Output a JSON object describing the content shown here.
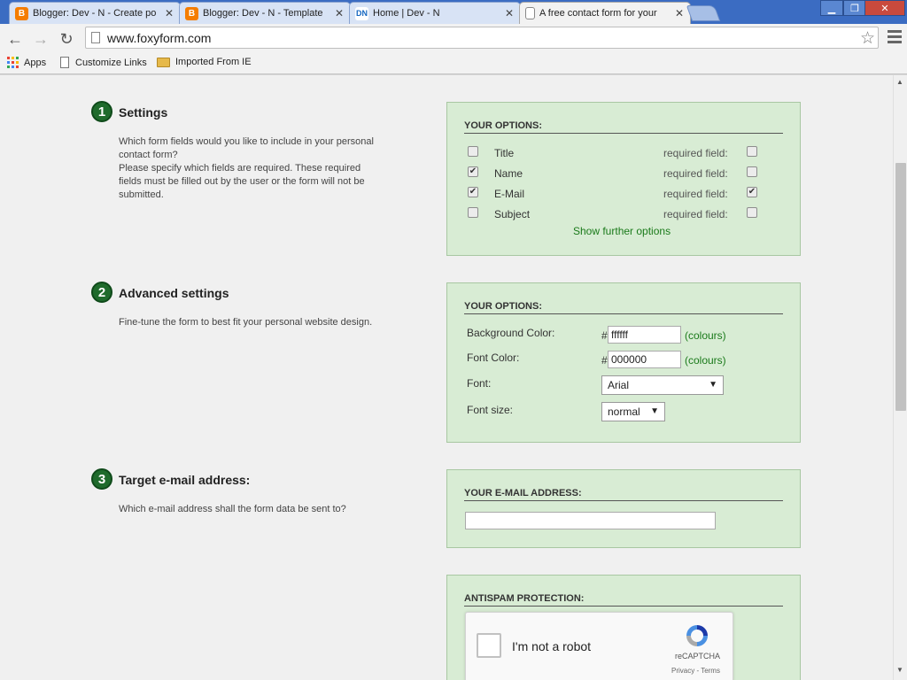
{
  "browser": {
    "tabs": [
      {
        "title": "Blogger: Dev - N - Create po",
        "favicon": "blogger-icon"
      },
      {
        "title": "Blogger: Dev - N - Template",
        "favicon": "blogger-icon"
      },
      {
        "title": "Home | Dev - N",
        "favicon": "devn-icon"
      },
      {
        "title": "A free contact form for your",
        "favicon": "page-icon"
      }
    ],
    "url": "www.foxyform.com",
    "bookmarks": [
      {
        "label": "Apps",
        "icon": "apps-icon"
      },
      {
        "label": "Customize Links",
        "icon": "page-icon"
      },
      {
        "label": "Imported From IE",
        "icon": "folder-icon"
      }
    ]
  },
  "steps": [
    {
      "number": "1",
      "title": "Settings",
      "description": [
        "Which form fields would you like to include in your personal",
        "contact form?",
        "Please specify which fields are required. These required",
        "fields must be filled out by the user or the form will not be",
        "submitted."
      ]
    },
    {
      "number": "2",
      "title": "Advanced settings",
      "description": [
        "Fine-tune the form to best fit your personal website design."
      ]
    },
    {
      "number": "3",
      "title": "Target e-mail address:",
      "description": [
        "Which e-mail address shall the form data be sent to?"
      ]
    }
  ],
  "panel1": {
    "heading": "YOUR OPTIONS:",
    "required_label": "required field:",
    "fields": [
      {
        "label": "Title",
        "included": false,
        "required": false
      },
      {
        "label": "Name",
        "included": true,
        "required": false
      },
      {
        "label": "E-Mail",
        "included": true,
        "required": true
      },
      {
        "label": "Subject",
        "included": false,
        "required": false
      }
    ],
    "more_link": "Show further options"
  },
  "panel2": {
    "heading": "YOUR OPTIONS:",
    "bg_label": "Background Color:",
    "bg_value": "ffffff",
    "font_color_label": "Font Color:",
    "font_color_value": "000000",
    "hash": "#",
    "colours_link": "(colours)",
    "font_label": "Font:",
    "font_value": "Arial",
    "size_label": "Font size:",
    "size_value": "normal"
  },
  "panel3": {
    "heading": "YOUR E-MAIL ADDRESS:",
    "email_value": ""
  },
  "panel4": {
    "heading": "ANTISPAM PROTECTION:",
    "captcha_text": "I'm not a robot",
    "captcha_brand": "reCAPTCHA",
    "captcha_terms": "Privacy - Terms"
  },
  "colors": {
    "panel_bg": "#d8ecd4",
    "step_circle": "#1f6b2c",
    "link": "#1a7a1a"
  }
}
